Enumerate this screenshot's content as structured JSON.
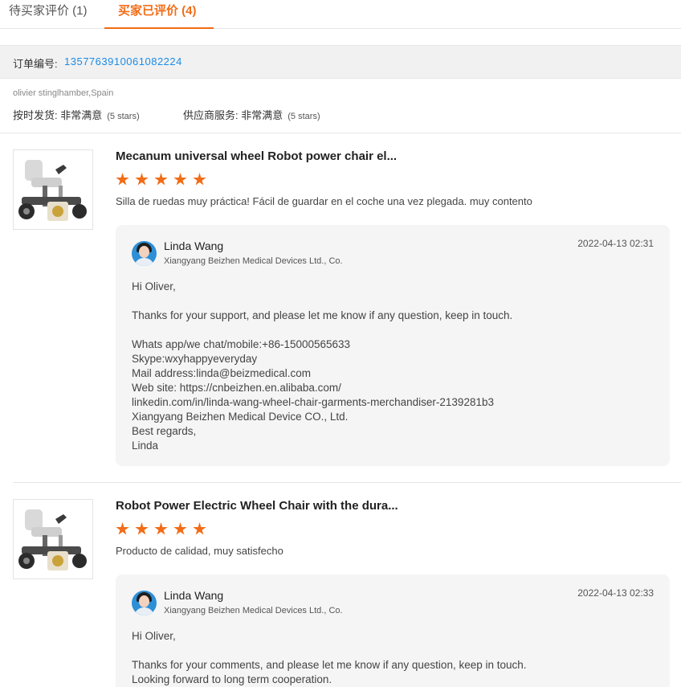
{
  "tabs": [
    {
      "label": "待买家评价 (1)"
    },
    {
      "label": "买家已评价 (4)"
    }
  ],
  "order": {
    "label": "订单编号:",
    "number": "1357763910061082224"
  },
  "buyer_line": "olivier stinglhamber,Spain",
  "ratings": {
    "shipping": {
      "label": "按时发货:",
      "value": "非常满意",
      "stars": "(5 stars)"
    },
    "service": {
      "label": "供应商服务:",
      "value": "非常满意",
      "stars": "(5 stars)"
    }
  },
  "colors": {
    "accent": "#f26c16",
    "link": "#1a8ce8"
  },
  "reviews": [
    {
      "title": "Mecanum universal wheel Robot power chair el...",
      "stars": 5,
      "comment": "Silla de ruedas muy práctica! Fácil de guardar en el coche una vez plegada. muy contento",
      "reply": {
        "name": "Linda Wang",
        "company": "Xiangyang Beizhen Medical Devices Ltd., Co.",
        "date": "2022-04-13 02:31",
        "lines": [
          "Hi Oliver,",
          "",
          "Thanks for your support, and please let me know if any question, keep in touch.",
          "",
          "Whats app/we chat/mobile:+86-15000565633",
          "Skype:wxyhappyeveryday",
          "Mail address:linda@beizmedical.com",
          "Web site: https://cnbeizhen.en.alibaba.com/",
          "linkedin.com/in/linda-wang-wheel-chair-garments-merchandiser-2139281b3",
          "Xiangyang Beizhen Medical Device CO., Ltd.",
          "Best regards,",
          "Linda"
        ]
      }
    },
    {
      "title": "Robot Power Electric Wheel Chair with the dura...",
      "stars": 5,
      "comment": "Producto de calidad, muy satisfecho",
      "reply": {
        "name": "Linda Wang",
        "company": "Xiangyang Beizhen Medical Devices Ltd., Co.",
        "date": "2022-04-13 02:33",
        "lines": [
          "Hi Oliver,",
          "",
          "Thanks for your comments, and please let me know if any question, keep in touch.",
          "Looking forward to long term cooperation."
        ]
      }
    }
  ]
}
